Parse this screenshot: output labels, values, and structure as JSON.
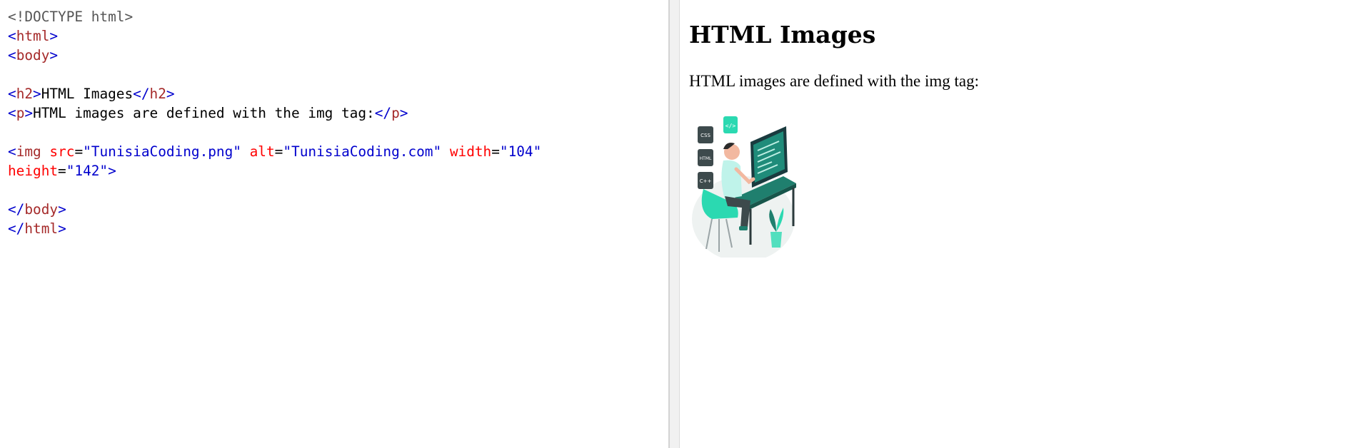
{
  "editor": {
    "lines": [
      [
        {
          "c": "doc",
          "t": "<!DOCTYPE html>"
        }
      ],
      [
        {
          "c": "br",
          "t": "<"
        },
        {
          "c": "tag",
          "t": "html"
        },
        {
          "c": "br",
          "t": ">"
        }
      ],
      [
        {
          "c": "br",
          "t": "<"
        },
        {
          "c": "tag",
          "t": "body"
        },
        {
          "c": "br",
          "t": ">"
        }
      ],
      [],
      [
        {
          "c": "br",
          "t": "<"
        },
        {
          "c": "tag",
          "t": "h2"
        },
        {
          "c": "br",
          "t": ">"
        },
        {
          "c": "txt",
          "t": "HTML Images"
        },
        {
          "c": "br",
          "t": "</"
        },
        {
          "c": "tag",
          "t": "h2"
        },
        {
          "c": "br",
          "t": ">"
        }
      ],
      [
        {
          "c": "br",
          "t": "<"
        },
        {
          "c": "tag",
          "t": "p"
        },
        {
          "c": "br",
          "t": ">"
        },
        {
          "c": "txt",
          "t": "HTML images are defined with the img tag:"
        },
        {
          "c": "br",
          "t": "</"
        },
        {
          "c": "tag",
          "t": "p"
        },
        {
          "c": "br",
          "t": ">"
        }
      ],
      [],
      [
        {
          "c": "br",
          "t": "<"
        },
        {
          "c": "tag",
          "t": "img"
        },
        {
          "c": "txt",
          "t": " "
        },
        {
          "c": "attr",
          "t": "src"
        },
        {
          "c": "txt",
          "t": "="
        },
        {
          "c": "val",
          "t": "\"TunisiaCoding.png\""
        },
        {
          "c": "txt",
          "t": " "
        },
        {
          "c": "attr",
          "t": "alt"
        },
        {
          "c": "txt",
          "t": "="
        },
        {
          "c": "val",
          "t": "\"TunisiaCoding.com\""
        },
        {
          "c": "txt",
          "t": " "
        },
        {
          "c": "attr",
          "t": "width"
        },
        {
          "c": "txt",
          "t": "="
        },
        {
          "c": "val",
          "t": "\"104\""
        }
      ],
      [
        {
          "c": "attr",
          "t": "height"
        },
        {
          "c": "txt",
          "t": "="
        },
        {
          "c": "val",
          "t": "\"142\""
        },
        {
          "c": "br",
          "t": ">"
        }
      ],
      [],
      [
        {
          "c": "br",
          "t": "</"
        },
        {
          "c": "tag",
          "t": "body"
        },
        {
          "c": "br",
          "t": ">"
        }
      ],
      [
        {
          "c": "br",
          "t": "</"
        },
        {
          "c": "tag",
          "t": "html"
        },
        {
          "c": "br",
          "t": ">"
        }
      ]
    ]
  },
  "preview": {
    "heading": "HTML Images",
    "paragraph": "HTML images are defined with the img tag:",
    "image": {
      "icon": "developer-at-desk-illustration",
      "alt": "TunisiaCoding.com",
      "badges": [
        "CSS",
        "HTML",
        "C++"
      ]
    }
  },
  "colors": {
    "tag": "#a52a2a",
    "bracket": "#0000cd",
    "attribute": "#ff0000",
    "value": "#0000cd",
    "accent": "#2bd9b1"
  }
}
